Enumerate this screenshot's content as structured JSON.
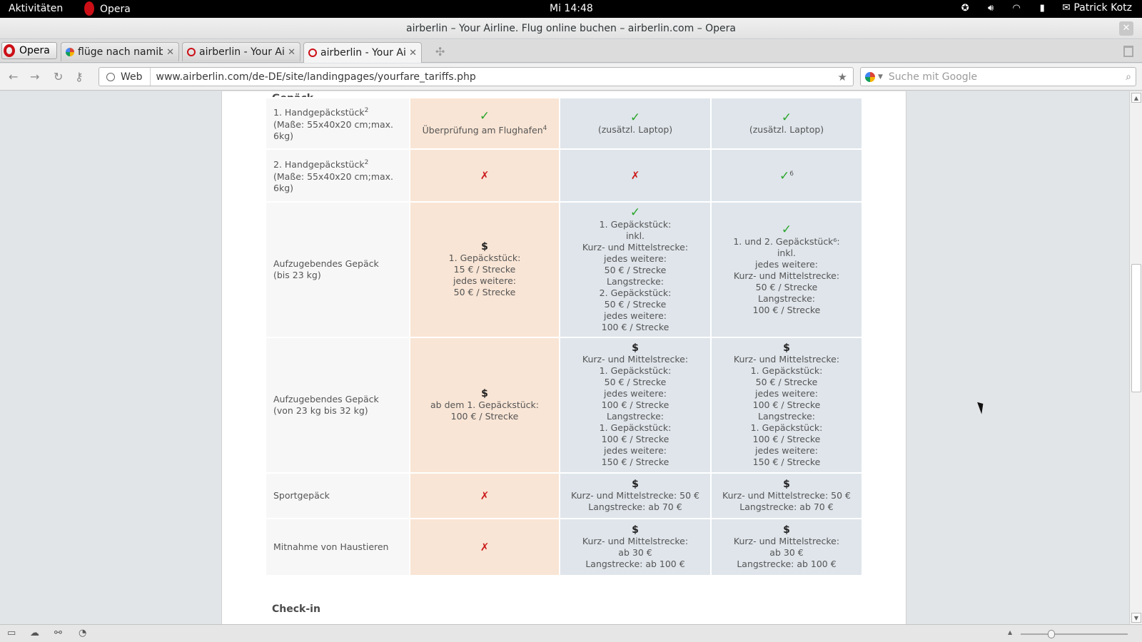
{
  "topbar": {
    "activities": "Aktivitäten",
    "app_name": "Opera",
    "clock": "Mi 14:48",
    "user": "Patrick Kotz"
  },
  "window": {
    "title": "airberlin – Your Airline. Flug online buchen – airberlin.com – Opera"
  },
  "tabs": [
    {
      "label": "flüge nach namibia..."
    },
    {
      "label": "airberlin - Your Ai..."
    },
    {
      "label": "airberlin - Your Ai..."
    }
  ],
  "opera_button": "Opera",
  "address": {
    "web_label": "Web",
    "url": "www.airberlin.com/de-DE/site/landingpages/yourfare_tariffs.php",
    "search_placeholder": "Suche mit Google"
  },
  "page": {
    "section_gepaeck": "Gepäck",
    "section_checkin": "Check-in",
    "rows": [
      {
        "label_lines": [
          "1. Handgepäckstück",
          "(Maße: 55x40x20 cm;max.",
          "6kg)"
        ],
        "label_sup": "2",
        "c1": {
          "icon": "check",
          "lines": [
            "Überprüfung am Flughafen"
          ],
          "sup": "4"
        },
        "c2": {
          "icon": "check",
          "lines": [
            "(zusätzl. Laptop)"
          ]
        },
        "c3": {
          "icon": "check",
          "lines": [
            "(zusätzl. Laptop)"
          ]
        }
      },
      {
        "label_lines": [
          "2. Handgepäckstück",
          "(Maße: 55x40x20 cm;max.",
          "6kg)"
        ],
        "label_sup": "2",
        "c1": {
          "icon": "cross",
          "lines": []
        },
        "c2": {
          "icon": "cross",
          "lines": []
        },
        "c3": {
          "icon": "check",
          "lines": [],
          "sup": "6"
        }
      },
      {
        "label_lines": [
          "Aufzugebendes Gepäck",
          "(bis 23 kg)"
        ],
        "c1": {
          "icon": "dollar",
          "lines": [
            "1. Gepäckstück:",
            "15 € / Strecke",
            "jedes weitere:",
            "50 € / Strecke"
          ]
        },
        "c2": {
          "icon": "check",
          "lines": [
            "1. Gepäckstück:",
            "inkl.",
            "Kurz- und Mittelstrecke:",
            "jedes weitere:",
            "50 € / Strecke",
            "Langstrecke:",
            "2. Gepäckstück:",
            "50 € / Strecke",
            "jedes weitere:",
            "100 € / Strecke"
          ]
        },
        "c3": {
          "icon": "check",
          "lines": [
            "1. und 2. Gepäckstück⁶:",
            "inkl.",
            "jedes weitere:",
            "Kurz- und Mittelstrecke:",
            "50 € / Strecke",
            "Langstrecke:",
            "100 € / Strecke"
          ]
        }
      },
      {
        "label_lines": [
          "Aufzugebendes Gepäck",
          "(von 23 kg bis 32 kg)"
        ],
        "c1": {
          "icon": "dollar",
          "lines": [
            "ab dem 1. Gepäckstück:",
            "100 € / Strecke"
          ]
        },
        "c2": {
          "icon": "dollar",
          "lines": [
            "Kurz- und Mittelstrecke:",
            "1. Gepäckstück:",
            "50 € / Strecke",
            "jedes weitere:",
            "100 € / Strecke",
            "Langstrecke:",
            "1. Gepäckstück:",
            "100 € / Strecke",
            "jedes weitere:",
            "150 € / Strecke"
          ]
        },
        "c3": {
          "icon": "dollar",
          "lines": [
            "Kurz- und Mittelstrecke:",
            "1. Gepäckstück:",
            "50 € / Strecke",
            "jedes weitere:",
            "100 € / Strecke",
            "Langstrecke:",
            "1. Gepäckstück:",
            "100 € / Strecke",
            "jedes weitere:",
            "150 € / Strecke"
          ]
        }
      },
      {
        "label_lines": [
          "Sportgepäck"
        ],
        "c1": {
          "icon": "cross",
          "lines": []
        },
        "c2": {
          "icon": "dollar",
          "lines": [
            "Kurz- und Mittelstrecke: 50 €",
            "Langstrecke: ab 70 €"
          ]
        },
        "c3": {
          "icon": "dollar",
          "lines": [
            "Kurz- und Mittelstrecke: 50 €",
            "Langstrecke: ab 70 €"
          ]
        }
      },
      {
        "label_lines": [
          "Mitnahme von Haustieren"
        ],
        "c1": {
          "icon": "cross",
          "lines": []
        },
        "c2": {
          "icon": "dollar",
          "lines": [
            "Kurz- und Mittelstrecke:",
            "ab 30 €",
            "Langstrecke: ab 100 €"
          ]
        },
        "c3": {
          "icon": "dollar",
          "lines": [
            "Kurz- und Mittelstrecke:",
            "ab 30 €",
            "Langstrecke: ab 100 €"
          ]
        }
      }
    ]
  },
  "status": {
    "zoom_fraction": 0.27
  },
  "colors": {
    "col_basic": "#f9e5d5",
    "col_other": "#dfe5eb",
    "check": "#2aa52a",
    "cross": "#cc1c1c"
  }
}
